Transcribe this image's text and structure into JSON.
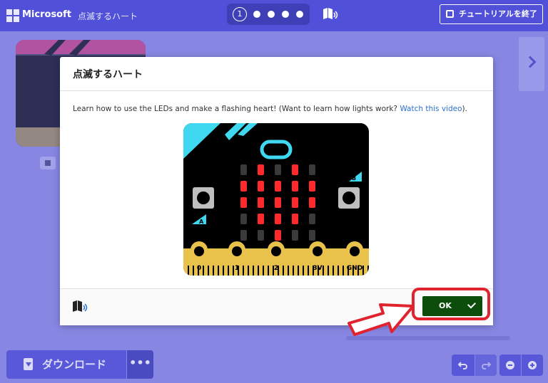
{
  "header": {
    "brand": "Microsoft",
    "project_title": "点滅するハート",
    "step_number": "1",
    "finish_button": "チュートリアルを終了"
  },
  "dialog": {
    "title": "点滅するハート",
    "text_before_link": "Learn how to use the LEDs and make a flashing heart! (Want to learn how lights work? ",
    "link_text": "Watch this video",
    "text_after_link": ").",
    "ok_label": "OK"
  },
  "board": {
    "pin_labels": [
      "0",
      "1",
      "2",
      "3V",
      "GND"
    ],
    "button_a": "A",
    "button_b": "B"
  },
  "toolbar": {
    "download_label": "ダウンロード",
    "more_label": "•••"
  },
  "colors": {
    "header": "#5050d8",
    "ok_button": "#0c4d0c",
    "highlight": "#e0232e",
    "led_on": "#ff2b2b",
    "board_cyan": "#3fd8f0",
    "board_gold": "#e8c24a"
  }
}
